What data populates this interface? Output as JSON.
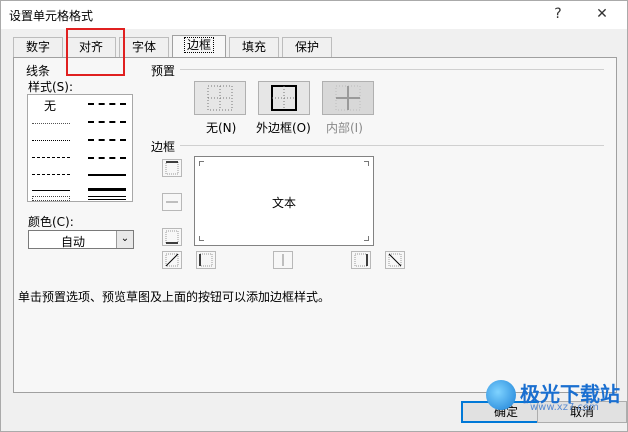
{
  "window": {
    "title": "设置单元格格式",
    "help_label": "?",
    "close_label": "✕"
  },
  "tabs": [
    {
      "label": "数字"
    },
    {
      "label": "对齐"
    },
    {
      "label": "字体"
    },
    {
      "label": "边框",
      "active": true
    },
    {
      "label": "填充"
    },
    {
      "label": "保护"
    }
  ],
  "line": {
    "section_label": "线条",
    "style_label": "样式(S):",
    "none_label": "无",
    "color_label": "颜色(C):",
    "color_value": "自动",
    "dropdown_glyph": "⌄"
  },
  "presets": {
    "section_label": "预置",
    "items": [
      {
        "label": "无(N)",
        "icon": "border-none-icon",
        "enabled": true
      },
      {
        "label": "外边框(O)",
        "icon": "border-outline-icon",
        "enabled": true
      },
      {
        "label": "内部(I)",
        "icon": "border-inside-icon",
        "enabled": false
      }
    ]
  },
  "border": {
    "section_label": "边框",
    "preview_text": "文本"
  },
  "hint": "单击预置选项、预览草图及上面的按钮可以添加边框样式。",
  "buttons": {
    "ok": "确定",
    "cancel": "取消"
  },
  "watermark": {
    "text": "极光下载站",
    "url": "www.xz7.com"
  },
  "colors": {
    "accent": "#0078d7",
    "highlight": "#e02020"
  }
}
